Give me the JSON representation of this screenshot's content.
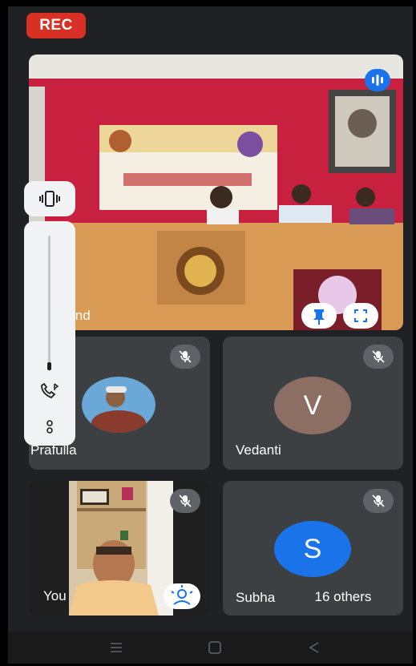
{
  "recording": {
    "label": "REC",
    "color": "#d93025"
  },
  "main_tile": {
    "participant": "ind",
    "pin_icon": "pin-icon",
    "fullscreen_icon": "fullscreen-icon",
    "speaking_icon": "audio-activity-icon"
  },
  "tiles": [
    {
      "name": "Prafulla",
      "muted": true,
      "avatar_type": "photo"
    },
    {
      "name": "Vedanti",
      "muted": true,
      "avatar_letter": "V",
      "avatar_color": "#8d6e63"
    },
    {
      "name": "You",
      "muted": true,
      "avatar_type": "video",
      "effects_icon": "visual-effects-icon"
    },
    {
      "name": "Subha",
      "muted": true,
      "avatar_letter": "S",
      "avatar_color": "#1a73e8"
    }
  ],
  "others_chip": {
    "label": "16 others"
  },
  "volume_panel": {
    "ringer_mode_icon": "vibrate-icon",
    "call_volume_icon": "bluetooth-call-icon",
    "more_icon": "more-options-icon",
    "level": 0.05
  },
  "nav_bar": {
    "recents_icon": "recents-icon",
    "home_icon": "home-icon",
    "back_icon": "back-icon"
  }
}
